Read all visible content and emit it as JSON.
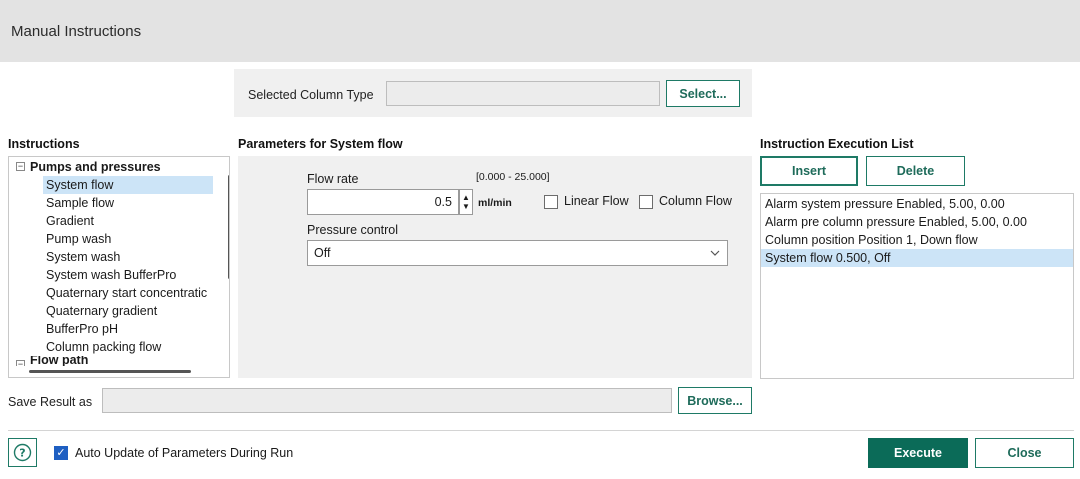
{
  "window": {
    "title": "Manual Instructions"
  },
  "column_type": {
    "label": "Selected Column Type",
    "value": "",
    "select_label": "Select..."
  },
  "instructions": {
    "heading": "Instructions",
    "group": "Pumps and pressures",
    "items": [
      "System flow",
      "Sample flow",
      "Gradient",
      "Pump wash",
      "System wash",
      "System wash BufferPro",
      "Quaternary start concentratic",
      "Quaternary gradient",
      "BufferPro pH",
      "Column packing flow"
    ],
    "next_group": "Flow path",
    "selected": "System flow"
  },
  "parameters": {
    "heading": "Parameters for System flow",
    "flow_rate_label": "Flow rate",
    "flow_rate_range": "[0.000 - 25.000]",
    "flow_rate_value": "0.5",
    "flow_rate_unit": "ml/min",
    "linear_flow_label": "Linear Flow",
    "column_flow_label": "Column Flow",
    "pressure_control_label": "Pressure control",
    "pressure_control_value": "Off"
  },
  "execution_list": {
    "heading": "Instruction Execution List",
    "insert_label": "Insert",
    "delete_label": "Delete",
    "items": [
      "Alarm system pressure Enabled, 5.00, 0.00",
      "Alarm pre column pressure Enabled, 5.00, 0.00",
      "Column position Position 1, Down flow",
      "System flow 0.500, Off"
    ],
    "selected_index": 3
  },
  "save_result": {
    "label": "Save Result as",
    "value": "",
    "browse_label": "Browse..."
  },
  "footer": {
    "auto_update_label": "Auto Update of Parameters During Run",
    "auto_update_checked": true,
    "execute_label": "Execute",
    "close_label": "Close"
  },
  "colors": {
    "accent": "#0b6b58",
    "selection": "#cce4f7"
  }
}
